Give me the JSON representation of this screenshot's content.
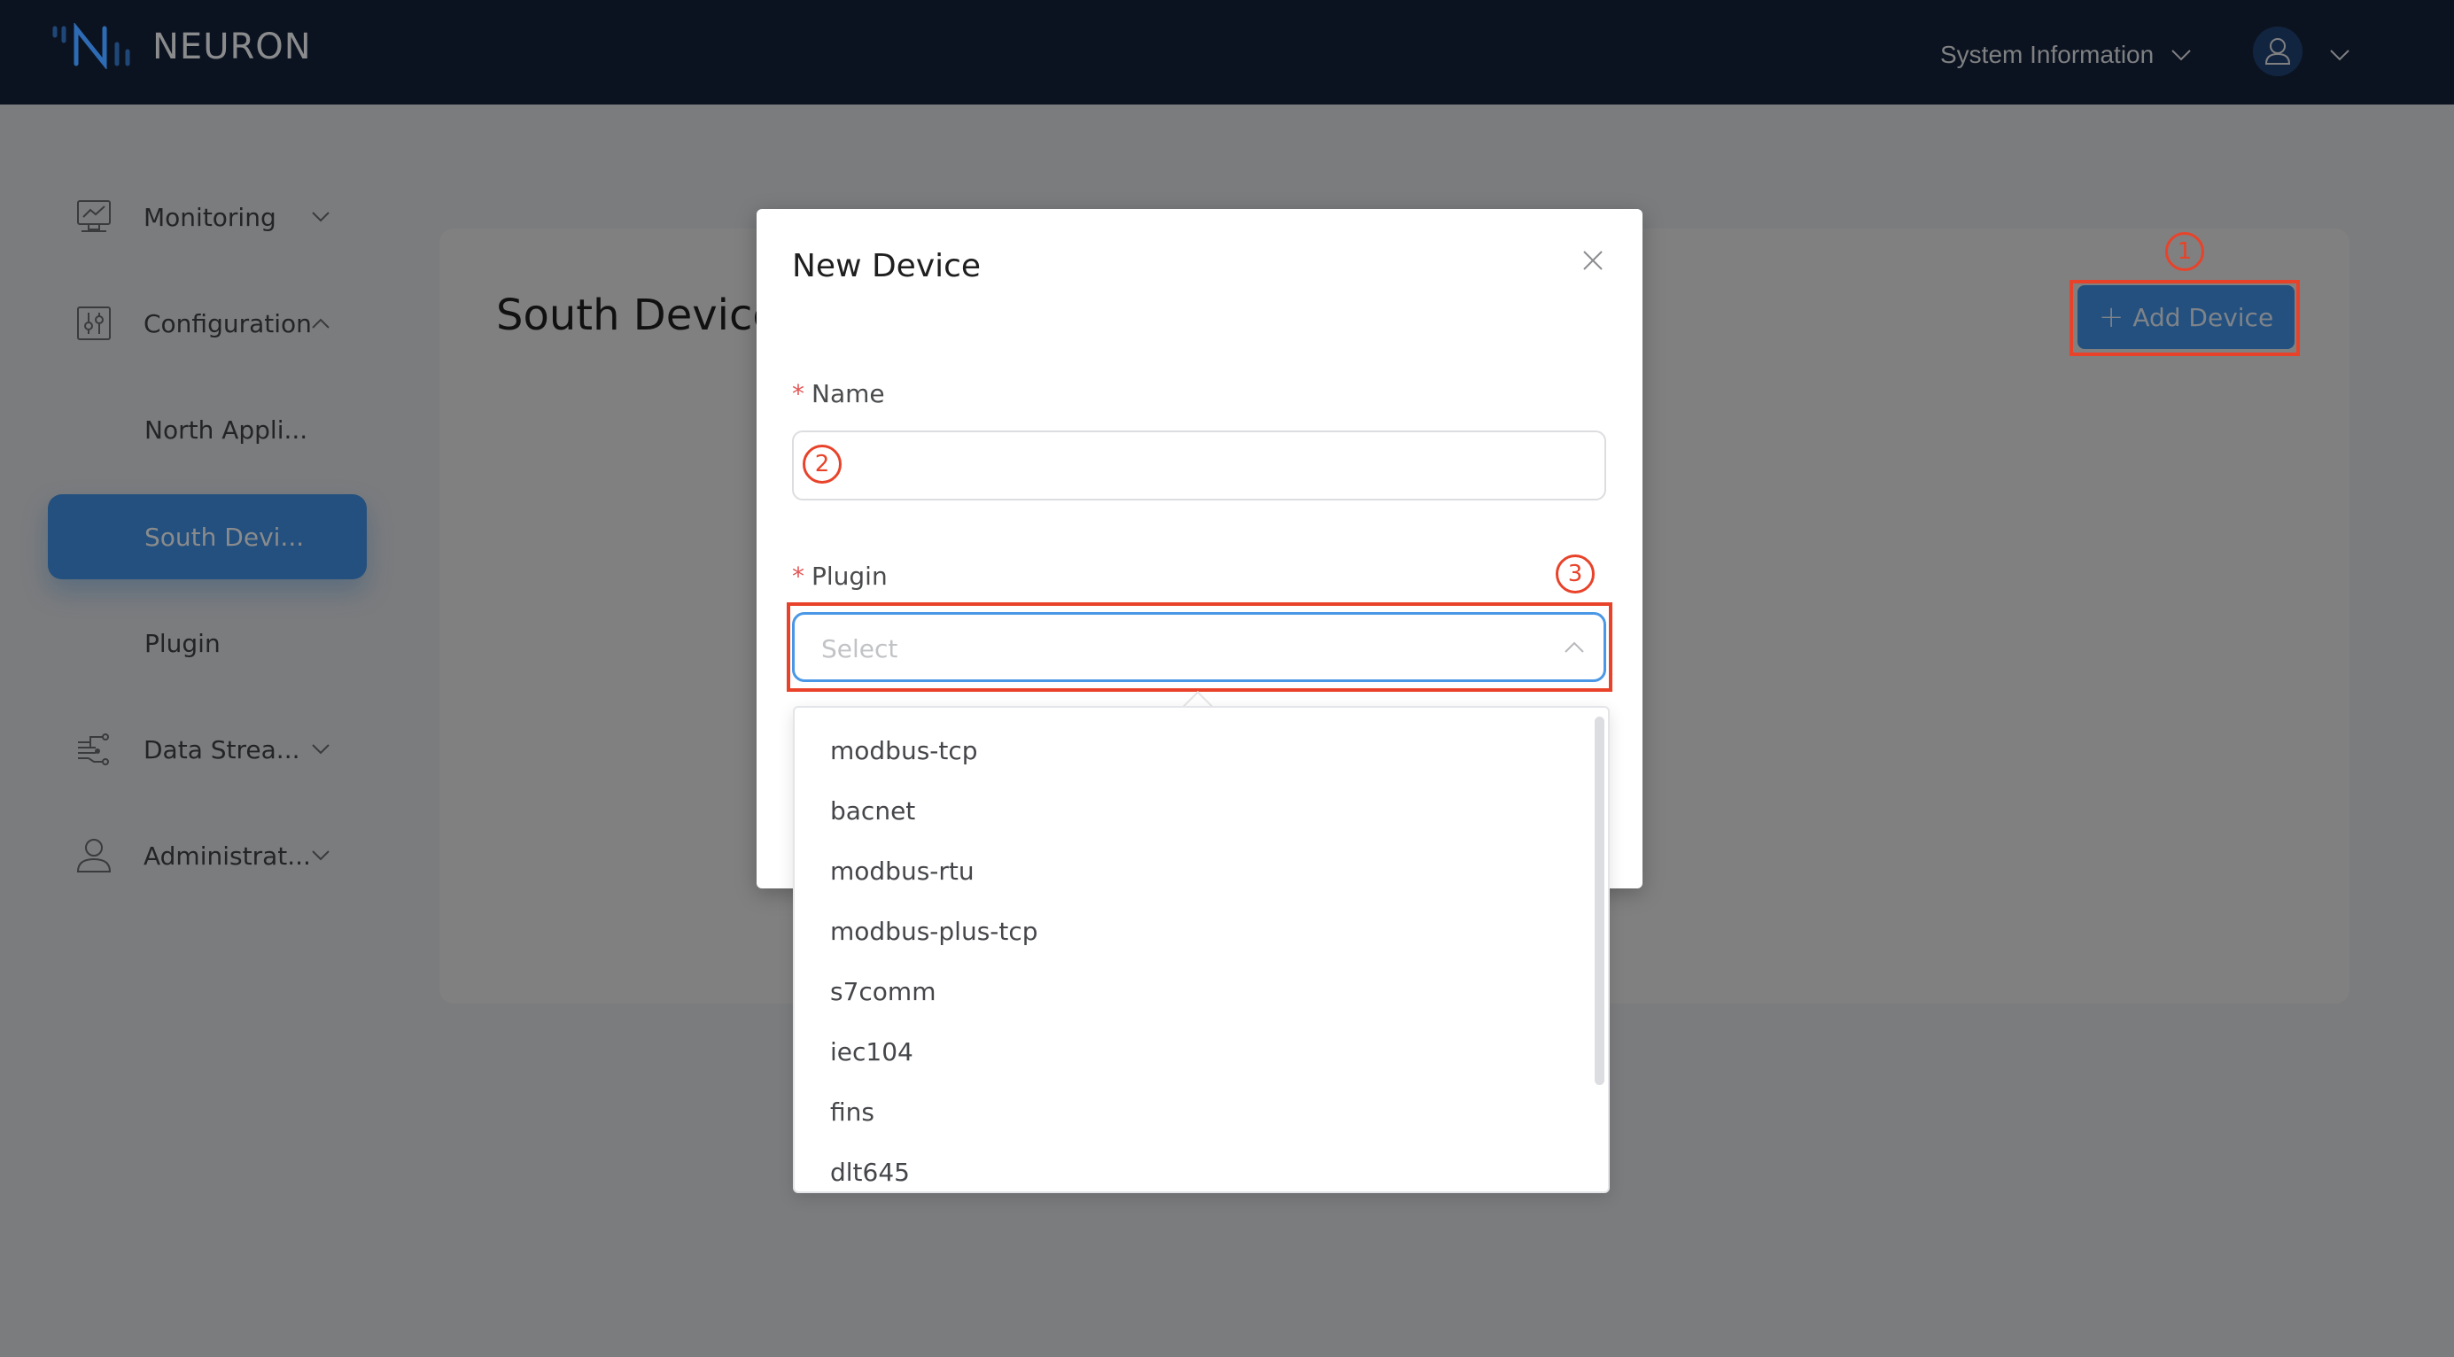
{
  "header": {
    "brand": "NEURON",
    "system_info_label": "System Information",
    "colors": {
      "bar": "#0c1320",
      "logo": "#2d6bb4"
    }
  },
  "sidebar": {
    "items": [
      {
        "label": "Monitoring",
        "icon": "monitor-chart-icon",
        "expanded": false
      },
      {
        "label": "Configuration",
        "icon": "sliders-icon",
        "expanded": true
      },
      {
        "label": "North Appli...",
        "sub": true
      },
      {
        "label": "South Devi...",
        "sub": true,
        "active": true
      },
      {
        "label": "Plugin",
        "sub": true
      },
      {
        "label": "Data Strea...",
        "icon": "data-stream-icon",
        "expanded": false
      },
      {
        "label": "Administrat...",
        "icon": "user-icon",
        "expanded": false
      }
    ]
  },
  "main": {
    "page_title": "South Device",
    "add_button_label": "Add Device"
  },
  "annotations": {
    "step1": "1",
    "step2": "2",
    "step3": "3",
    "color": "#e8432a"
  },
  "modal": {
    "title": "New Device",
    "name_field": {
      "label": "Name",
      "required_mark": "*",
      "value": "",
      "placeholder": ""
    },
    "plugin_field": {
      "label": "Plugin",
      "required_mark": "*",
      "placeholder": "Select",
      "open": true
    },
    "plugin_options": [
      "modbus-tcp",
      "bacnet",
      "modbus-rtu",
      "modbus-plus-tcp",
      "s7comm",
      "iec104",
      "fins",
      "dlt645"
    ]
  }
}
